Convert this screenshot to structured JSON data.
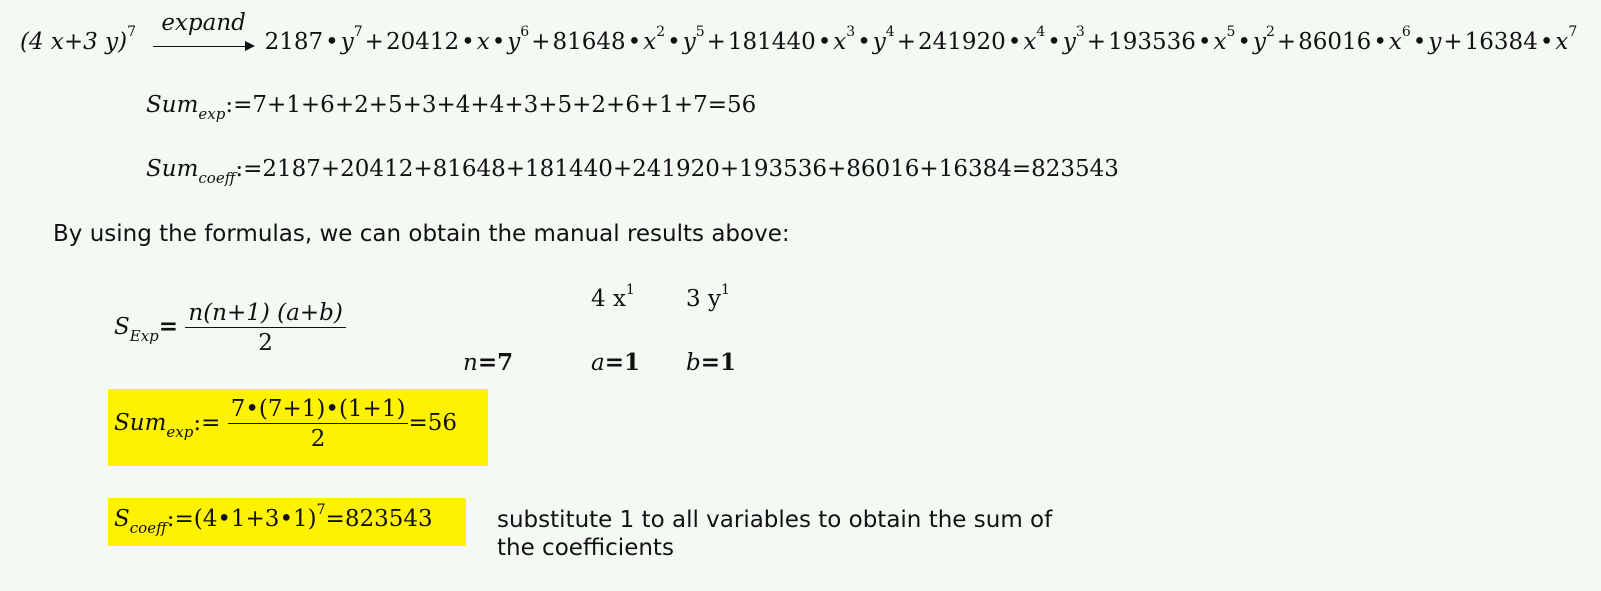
{
  "expansion": {
    "lhs": "(4 x+3 y)",
    "lhs_power": "7",
    "operator": "expand",
    "rhs_terms": [
      {
        "coeff": "2187",
        "x": "",
        "xp": "",
        "y": "y",
        "yp": "7"
      },
      {
        "coeff": "20412",
        "x": "x",
        "xp": "",
        "y": "y",
        "yp": "6"
      },
      {
        "coeff": "81648",
        "x": "x",
        "xp": "2",
        "y": "y",
        "yp": "5"
      },
      {
        "coeff": "181440",
        "x": "x",
        "xp": "3",
        "y": "y",
        "yp": "4"
      },
      {
        "coeff": "241920",
        "x": "x",
        "xp": "4",
        "y": "y",
        "yp": "3"
      },
      {
        "coeff": "193536",
        "x": "x",
        "xp": "5",
        "y": "y",
        "yp": "2"
      },
      {
        "coeff": "86016",
        "x": "x",
        "xp": "6",
        "y": "y",
        "yp": ""
      },
      {
        "coeff": "16384",
        "x": "x",
        "xp": "7",
        "y": "",
        "yp": ""
      }
    ]
  },
  "sum_exp_manual": {
    "name": "Sum",
    "subscript": "exp",
    "assign": ":=",
    "expression": "7+1+6+2+5+3+4+4+3+5+2+6+1+7=56"
  },
  "sum_coeff_manual": {
    "name": "Sum",
    "subscript": "coeff",
    "assign": ":=",
    "expression": "2187+20412+81648+181440+241920+193536+86016+16384=823543"
  },
  "intro_text": "By using the formulas, we can obtain the manual results above:",
  "formula_sexp": {
    "name": "S",
    "subscript": "Exp",
    "equals": "=",
    "numerator": "n(n+1) (a+b)",
    "denominator": "2"
  },
  "params": {
    "n_label": "n",
    "n_value": "=7",
    "term_a": "4 x",
    "term_a_power": "1",
    "term_b": "3 y",
    "term_b_power": "1",
    "a_label": "a",
    "a_value": "=1",
    "b_label": "b",
    "b_value": "=1"
  },
  "sum_exp_formula": {
    "name": "Sum",
    "subscript": "exp",
    "assign": ":=",
    "numerator": "7•(7+1)•(1+1)",
    "denominator": "2",
    "result": "=56"
  },
  "scoeff_formula": {
    "name": "S",
    "subscript": "coeff",
    "assign": ":=",
    "expression": "(4•1+3•1)",
    "power": "7",
    "result": "=823543"
  },
  "note_text_line1": "substitute 1 to all variables to obtain the sum of",
  "note_text_line2": "the coefficients",
  "colors": {
    "highlight": "#fff200",
    "background": "#f4f9f4"
  }
}
